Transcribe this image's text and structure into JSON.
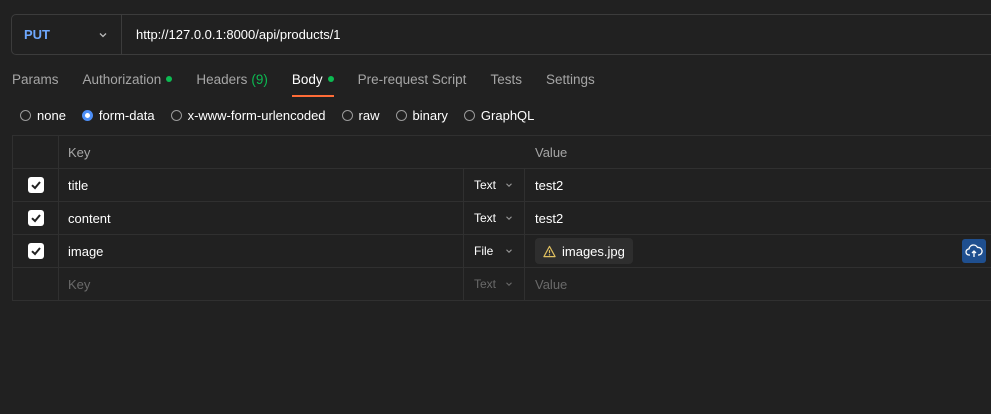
{
  "request": {
    "method": "PUT",
    "url": "http://127.0.0.1:8000/api/products/1"
  },
  "tabs": [
    {
      "label": "Params"
    },
    {
      "label": "Authorization"
    },
    {
      "label": "Headers",
      "count": "(9)"
    },
    {
      "label": "Body"
    },
    {
      "label": "Pre-request Script"
    },
    {
      "label": "Tests"
    },
    {
      "label": "Settings"
    }
  ],
  "body_types": [
    "none",
    "form-data",
    "x-www-form-urlencoded",
    "raw",
    "binary",
    "GraphQL"
  ],
  "table": {
    "headers": {
      "key": "Key",
      "value": "Value"
    },
    "rows": [
      {
        "key": "title",
        "type": "Text",
        "value": "test2"
      },
      {
        "key": "content",
        "type": "Text",
        "value": "test2"
      },
      {
        "key": "image",
        "type": "File",
        "value": "images.jpg"
      }
    ],
    "placeholder": {
      "key": "Key",
      "type": "Text",
      "value": "Value"
    }
  },
  "colors": {
    "accent": "#ff6c37",
    "method": "#6ea8fe",
    "success": "#0cbb52",
    "radio": "#4d8ff7"
  }
}
